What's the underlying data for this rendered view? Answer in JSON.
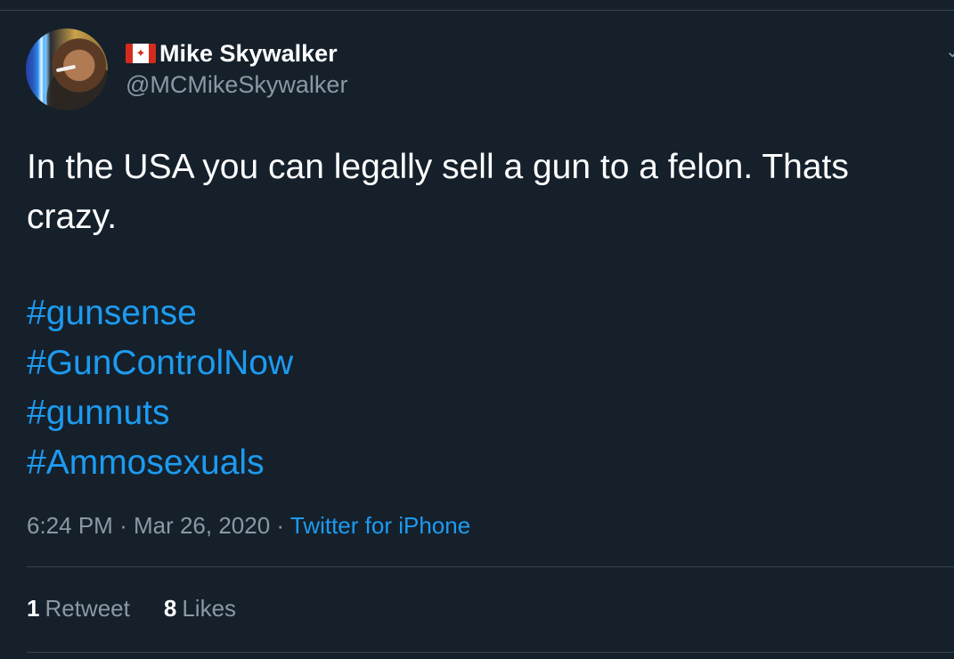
{
  "tweet": {
    "author": {
      "flag": "🇨🇦",
      "display_name": "Mike Skywalker",
      "handle": "@MCMikeSkywalker",
      "avatar_icon": "profile-photo"
    },
    "text": "In the USA you can legally sell a gun to a felon. Thats crazy.",
    "hashtags": [
      "#gunsense",
      "#GunControlNow",
      "#gunnuts",
      "#Ammosexuals"
    ],
    "time": "6:24 PM",
    "separator": "·",
    "date": "Mar 26, 2020",
    "source": "Twitter for iPhone",
    "stats": {
      "retweets_count": "1",
      "retweets_label": "Retweet",
      "likes_count": "8",
      "likes_label": "Likes"
    }
  },
  "colors": {
    "background": "#15202b",
    "text": "#ffffff",
    "muted": "#8b98a5",
    "link": "#1d9bf0",
    "border": "#38444d"
  }
}
